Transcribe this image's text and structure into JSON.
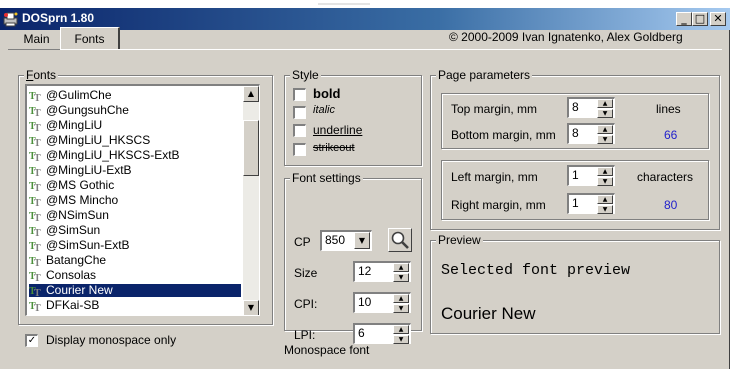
{
  "window": {
    "title": "DOSprn 1.80"
  },
  "titlebar_buttons": {
    "minimize": "_",
    "maximize": "□",
    "close": "✕"
  },
  "tabs": [
    {
      "label": "Main"
    },
    {
      "label": "Fonts"
    }
  ],
  "copyright": "© 2000-2009 Ivan Ignatenko, Alex Goldberg",
  "fonts_group": {
    "label": "Fonts",
    "items": [
      "@GulimChe",
      "@GungsuhChe",
      "@MingLiU",
      "@MingLiU_HKSCS",
      "@MingLiU_HKSCS-ExtB",
      "@MingLiU-ExtB",
      "@MS Gothic",
      "@MS Mincho",
      "@NSimSun",
      "@SimSun",
      "@SimSun-ExtB",
      "BatangChe",
      "Consolas",
      "Courier New",
      "DFKai-SB"
    ],
    "selected": "Courier New",
    "monospace_only_label": "Display monospace only",
    "monospace_only_checked": true
  },
  "style_group": {
    "label": "Style",
    "bold": "bold",
    "italic": "italic",
    "underline": "underline",
    "strikeout": "strikeout"
  },
  "font_settings": {
    "label": "Font settings",
    "cp_label": "CP",
    "cp_value": "850",
    "size_label": "Size",
    "size_value": "12",
    "cpi_label": "CPI:",
    "cpi_value": "10",
    "lpi_label": "LPI:",
    "lpi_value": "6"
  },
  "monospace_status": "Monospace font",
  "page_parameters": {
    "label": "Page parameters",
    "top_margin_label": "Top margin, mm",
    "top_margin_value": "8",
    "bottom_margin_label": "Bottom margin, mm",
    "bottom_margin_value": "8",
    "lines_label": "lines",
    "lines_value": "66",
    "left_margin_label": "Left margin, mm",
    "left_margin_value": "1",
    "right_margin_label": "Right margin, mm",
    "right_margin_value": "1",
    "characters_label": "characters",
    "characters_value": "80"
  },
  "preview": {
    "label": "Preview",
    "sample_text": "Selected font preview",
    "font_name": "Courier New"
  },
  "colors": {
    "titlebar_start": "#0a246a",
    "titlebar_end": "#a6caf0",
    "selection": "#0a246a",
    "value_blue": "#2222cc"
  }
}
